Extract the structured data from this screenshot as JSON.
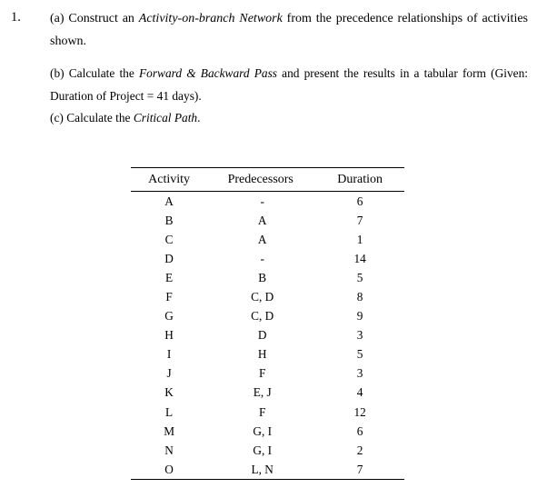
{
  "question": {
    "number": "1.",
    "part_a": {
      "prefix": "(a) Construct an ",
      "emphasis": "Activity-on-branch Network",
      "suffix": " from the precedence relationships of activities shown."
    },
    "part_b": {
      "prefix": "(b) Calculate the ",
      "emphasis": "Forward & Backward Pass",
      "suffix": " and present the results in a tabular form (Given: Duration of Project = 41 days)."
    },
    "part_c": {
      "prefix": "(c) Calculate the ",
      "emphasis": "Critical Path",
      "suffix": "."
    }
  },
  "table": {
    "headers": [
      "Activity",
      "Predecessors",
      "Duration"
    ],
    "rows": [
      {
        "activity": "A",
        "predecessors": "-",
        "duration": "6"
      },
      {
        "activity": "B",
        "predecessors": "A",
        "duration": "7"
      },
      {
        "activity": "C",
        "predecessors": "A",
        "duration": "1"
      },
      {
        "activity": "D",
        "predecessors": "-",
        "duration": "14"
      },
      {
        "activity": "E",
        "predecessors": "B",
        "duration": "5"
      },
      {
        "activity": "F",
        "predecessors": "C, D",
        "duration": "8"
      },
      {
        "activity": "G",
        "predecessors": "C, D",
        "duration": "9"
      },
      {
        "activity": "H",
        "predecessors": "D",
        "duration": "3"
      },
      {
        "activity": "I",
        "predecessors": "H",
        "duration": "5"
      },
      {
        "activity": "J",
        "predecessors": "F",
        "duration": "3"
      },
      {
        "activity": "K",
        "predecessors": "E, J",
        "duration": "4"
      },
      {
        "activity": "L",
        "predecessors": "F",
        "duration": "12"
      },
      {
        "activity": "M",
        "predecessors": "G, I",
        "duration": "6"
      },
      {
        "activity": "N",
        "predecessors": "G, I",
        "duration": "2"
      },
      {
        "activity": "O",
        "predecessors": "L, N",
        "duration": "7"
      }
    ]
  }
}
